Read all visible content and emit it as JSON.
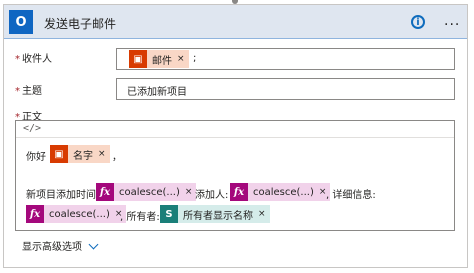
{
  "action": {
    "icon_glyph": "O",
    "title": "发送电子邮件",
    "info_label": "i",
    "more_label": "..."
  },
  "to_field": {
    "required_mark": "*",
    "label": "收件人",
    "token_label": "邮件",
    "token_close": "×",
    "trailing_text": ";"
  },
  "subject_field": {
    "required_mark": "*",
    "label": "主题",
    "value": "已添加新项目"
  },
  "body_field": {
    "required_mark": "*",
    "label": "正文",
    "code_toggle": "</>",
    "line1_prefix": "你好",
    "line1_token": "名字",
    "line1_suffix": "，",
    "line2_prefix": "新项目添加时间:",
    "expr_token_1": "coalesce(...)",
    "added_by_text": "添加人:",
    "expr_token_2": "coalesce(...)",
    "details_text": ", 详细信息:",
    "expr_token_3": "coalesce(...)",
    "owner_text": ", 所有者:",
    "owner_token": "所有者显示名称",
    "close_glyph": "×",
    "expr_glyph": "fx",
    "sp_glyph": "S"
  },
  "advanced_options": {
    "label": "显示高级选项"
  },
  "colors": {
    "office_token": "#d83b01",
    "expression_token": "#a4087c",
    "sharepoint_token": "#1a7f79",
    "accent": "#0f6cbd",
    "header_bg": "#dfe6f0"
  }
}
